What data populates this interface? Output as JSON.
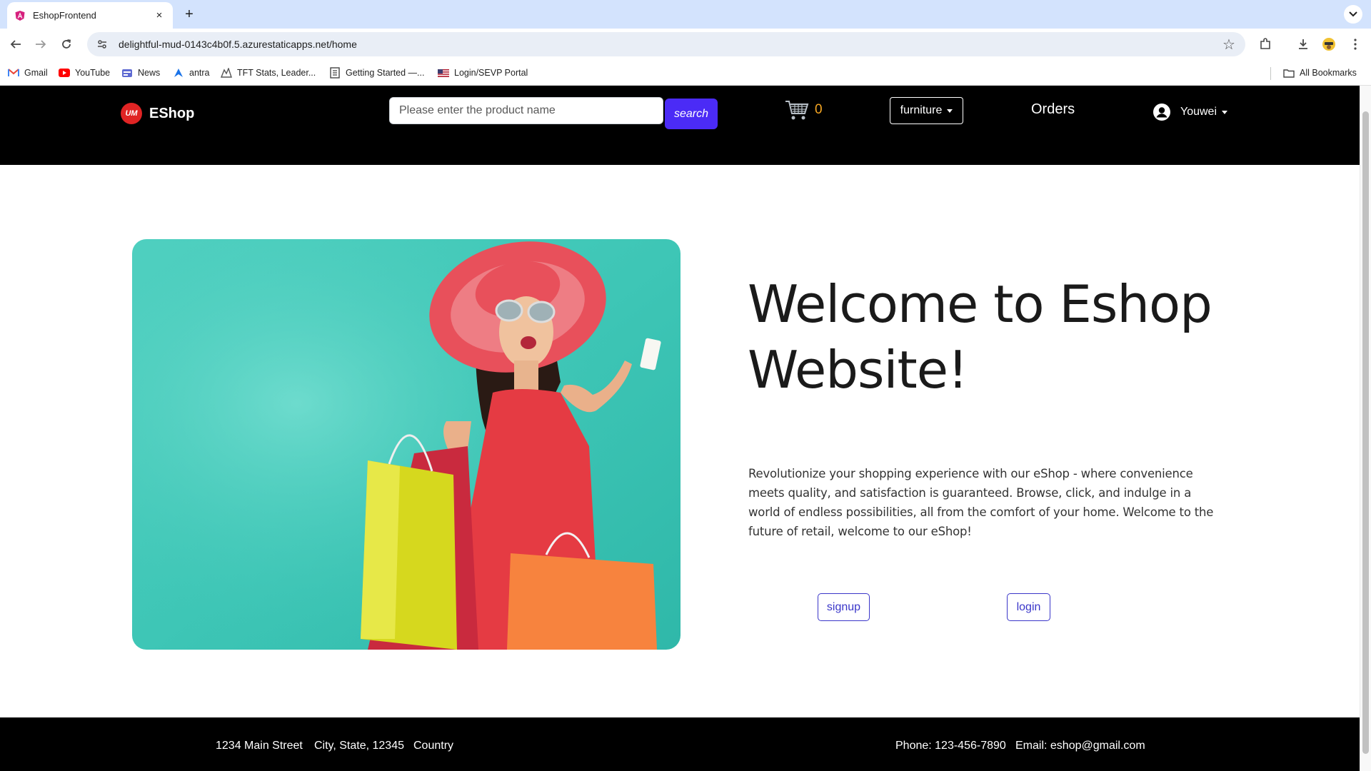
{
  "browser": {
    "tab_title": "EshopFrontend",
    "tab_close": "×",
    "new_tab": "+",
    "url": "delightful-mud-0143c4b0f.5.azurestaticapps.net/home",
    "bookmarks": [
      {
        "label": "Gmail",
        "icon": "gmail-icon"
      },
      {
        "label": "YouTube",
        "icon": "youtube-icon"
      },
      {
        "label": "News",
        "icon": "news-icon"
      },
      {
        "label": "antra",
        "icon": "antra-icon"
      },
      {
        "label": "TFT Stats, Leader...",
        "icon": "tft-icon"
      },
      {
        "label": "Getting Started —...",
        "icon": "doc-icon"
      },
      {
        "label": "Login/SEVP Portal",
        "icon": "flag-icon"
      }
    ],
    "all_bookmarks": "All Bookmarks"
  },
  "header": {
    "logo_badge": "UM",
    "logo_text": "EShop",
    "search_placeholder": "Please enter the product name",
    "search_button": "search",
    "cart_count": "0",
    "category": "furniture",
    "orders": "Orders",
    "user_name": "Youwei"
  },
  "hero": {
    "title": "Welcome to Eshop Website!",
    "description": "Revolutionize your shopping experience with our eShop - where convenience meets quality, and satisfaction is guaranteed. Browse, click, and indulge in a world of endless possibilities, all from the comfort of your home. Welcome to the future of retail, welcome to our eShop!",
    "signup": "signup",
    "login": "login"
  },
  "footer": {
    "street": "1234 Main Street",
    "city": "City, State, 12345",
    "country": "Country",
    "phone": "Phone: 123-456-7890",
    "email": "Email: eshop@gmail.com"
  },
  "colors": {
    "header_bg": "#000000",
    "search_button": "#4b2bf6",
    "cart_count": "#f5a623",
    "outline_button": "#3a36c9",
    "hero_teal": "#3cc5b4"
  }
}
